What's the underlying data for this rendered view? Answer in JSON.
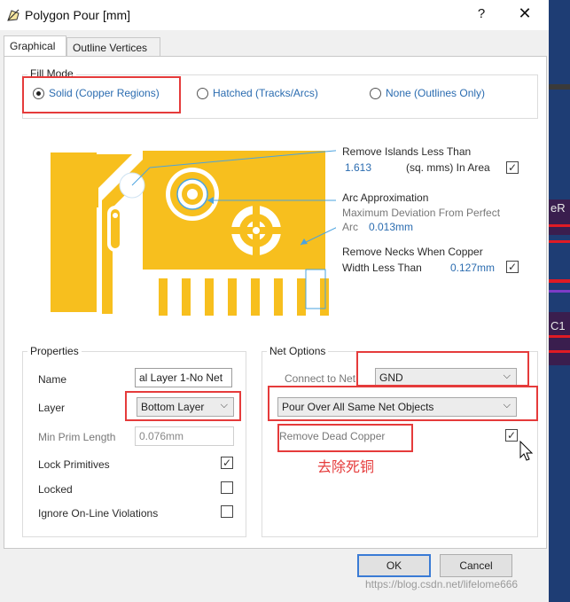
{
  "window": {
    "title": "Polygon Pour [mm]",
    "help": "?",
    "close": "✕"
  },
  "tabs": [
    {
      "label": "Graphical"
    },
    {
      "label": "Outline Vertices"
    }
  ],
  "fill_mode": {
    "legend": "Fill Mode",
    "options": [
      {
        "label": "Solid (Copper Regions)",
        "selected": true
      },
      {
        "label": "Hatched (Tracks/Arcs)",
        "selected": false
      },
      {
        "label": "None (Outlines Only)",
        "selected": false
      }
    ]
  },
  "diagram": {
    "copper_color": "#f7bf1e",
    "accent_color": "#4aa3df",
    "remove_islands": {
      "label": "Remove Islands Less Than",
      "value": "1.613",
      "unit": "(sq. mms) In Area",
      "checked": true
    },
    "arc_approx": {
      "label": "Arc Approximation",
      "desc1": "Maximum Deviation From Perfect",
      "desc2": "Arc",
      "value": "0.013mm"
    },
    "remove_necks": {
      "label1": "Remove Necks When Copper",
      "label2": "Width Less Than",
      "value": "0.127mm",
      "checked": true
    }
  },
  "properties": {
    "legend": "Properties",
    "name_label": "Name",
    "name_value": "al Layer 1-No Net",
    "layer_label": "Layer",
    "layer_value": "Bottom Layer",
    "min_prim_label": "Min Prim Length",
    "min_prim_value": "0.076mm",
    "lock_primitives_label": "Lock Primitives",
    "lock_primitives_checked": true,
    "locked_label": "Locked",
    "locked_checked": false,
    "ignore_online_label": "Ignore On-Line Violations",
    "ignore_online_checked": false
  },
  "net_options": {
    "legend": "Net Options",
    "connect_label": "Connect to Net",
    "connect_value": "GND",
    "pour_value": "Pour Over All Same Net Objects",
    "remove_dead_label": "Remove Dead Copper",
    "remove_dead_checked": true
  },
  "annotation": "去除死铜",
  "buttons": {
    "ok": "OK",
    "cancel": "Cancel"
  },
  "watermark": "https://blog.csdn.net/lifelome666",
  "background_fragments": {
    "a": "eR",
    "b": "C1"
  }
}
